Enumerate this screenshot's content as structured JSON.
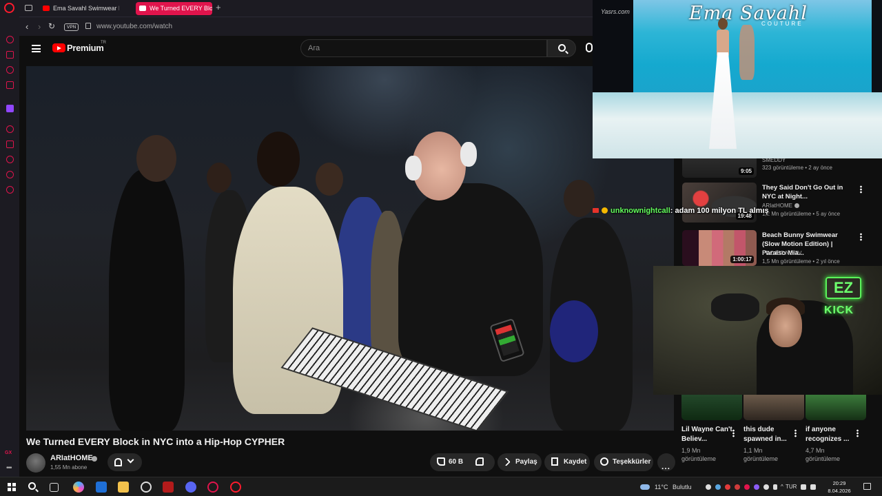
{
  "browser": {
    "tabs": [
      {
        "label": "Ema Savahl Swimwear Fas",
        "active": false
      },
      {
        "label": "We Turned EVERY Block",
        "active": true
      }
    ],
    "vpn_label": "VPN",
    "url": "www.youtube.com/watch"
  },
  "youtube": {
    "brand": "Premium",
    "brand_region": "TR",
    "search_placeholder": "Ara",
    "video": {
      "title": "We Turned EVERY Block in NYC into a Hip-Hop CYPHER",
      "channel": "ARIatHOME",
      "subscribers": "1,55 Mn abone",
      "likes": "60 B",
      "share_label": "Paylaş",
      "save_label": "Kaydet",
      "thanks_label": "Teşekkürler",
      "more_label": "..."
    },
    "recommendations": [
      {
        "title": "",
        "channel": "SMEDDY",
        "meta": "323 görüntüleme • 2 ay önce",
        "duration": "9:05",
        "verified": false
      },
      {
        "title": "They Said Don't Go Out in NYC at Night...",
        "channel": "ARIatHOME",
        "meta": "1,2 Mn görüntüleme • 5 ay önce",
        "duration": "19:48",
        "verified": true
      },
      {
        "title": "Beach Bunny Swimwear (Slow Motion Edition) | Paraiso Mia...",
        "channel": "PROJET NU TV",
        "meta": "1,5 Mn görüntüleme • 2 yıl önce",
        "duration": "1:00:17",
        "verified": false
      }
    ],
    "shorts": [
      {
        "title": "Lil Wayne Can't Believ...",
        "views_num": "1,9 Mn",
        "views_label": "görüntüleme"
      },
      {
        "title": "this dude spawned in...",
        "views_num": "1,1 Mn",
        "views_label": "görüntüleme"
      },
      {
        "title": "if anyone recognizes ...",
        "views_num": "4,7 Mn",
        "views_label": "görüntüleme"
      }
    ]
  },
  "overlays": {
    "runway": {
      "watermark": "Yasrs.com",
      "brand_name": "Ema Savahl",
      "brand_sub": "COUTURE"
    },
    "cam": {
      "logo_top": "EZ",
      "logo_bottom": "KICK"
    },
    "chat": {
      "user": "unknownightcall",
      "message": ": adam 100 milyon TL almış"
    }
  },
  "taskbar": {
    "weather_temp": "11°C",
    "weather_desc": "Bulutlu",
    "language": "TUR",
    "time": "20:29",
    "date": "8.04.2026"
  },
  "sidebar": {
    "gx_label": "GX"
  },
  "colors": {
    "opera_red": "#e0144c",
    "youtube_red": "#ff0000",
    "chat_user": "#64ff5e",
    "kick_green": "#6dff6d"
  }
}
